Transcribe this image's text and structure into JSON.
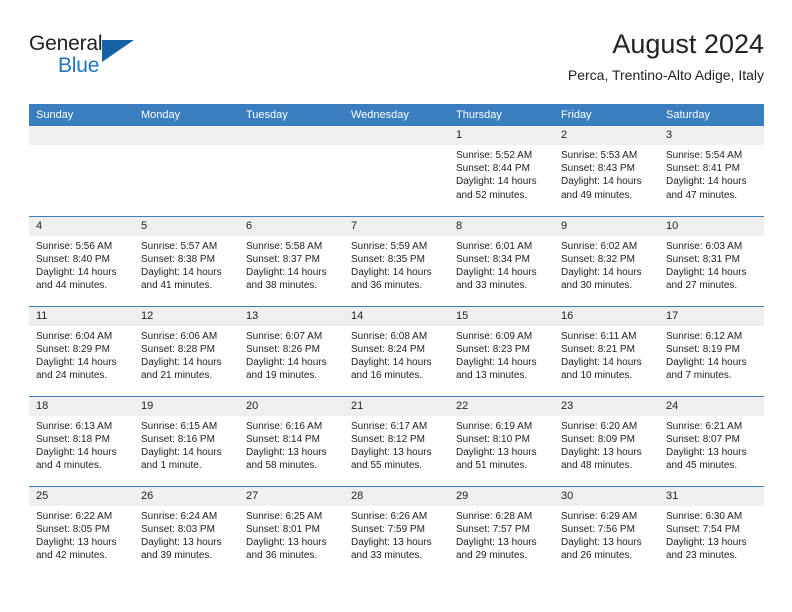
{
  "brand": {
    "word1": "General",
    "word2": "Blue",
    "accent_color": "#1464a5",
    "text_color": "#231f20"
  },
  "header": {
    "title": "August 2024",
    "subtitle": "Perca, Trentino-Alto Adige, Italy",
    "header_bg": "#3a7ebf",
    "daynum_bg": "#efefef"
  },
  "calendar": {
    "weekdays": [
      "Sunday",
      "Monday",
      "Tuesday",
      "Wednesday",
      "Thursday",
      "Friday",
      "Saturday"
    ],
    "weeks": [
      [
        {
          "day": "",
          "sunrise": "",
          "sunset": "",
          "daylight1": "",
          "daylight2": ""
        },
        {
          "day": "",
          "sunrise": "",
          "sunset": "",
          "daylight1": "",
          "daylight2": ""
        },
        {
          "day": "",
          "sunrise": "",
          "sunset": "",
          "daylight1": "",
          "daylight2": ""
        },
        {
          "day": "",
          "sunrise": "",
          "sunset": "",
          "daylight1": "",
          "daylight2": ""
        },
        {
          "day": "1",
          "sunrise": "Sunrise: 5:52 AM",
          "sunset": "Sunset: 8:44 PM",
          "daylight1": "Daylight: 14 hours",
          "daylight2": "and 52 minutes."
        },
        {
          "day": "2",
          "sunrise": "Sunrise: 5:53 AM",
          "sunset": "Sunset: 8:43 PM",
          "daylight1": "Daylight: 14 hours",
          "daylight2": "and 49 minutes."
        },
        {
          "day": "3",
          "sunrise": "Sunrise: 5:54 AM",
          "sunset": "Sunset: 8:41 PM",
          "daylight1": "Daylight: 14 hours",
          "daylight2": "and 47 minutes."
        }
      ],
      [
        {
          "day": "4",
          "sunrise": "Sunrise: 5:56 AM",
          "sunset": "Sunset: 8:40 PM",
          "daylight1": "Daylight: 14 hours",
          "daylight2": "and 44 minutes."
        },
        {
          "day": "5",
          "sunrise": "Sunrise: 5:57 AM",
          "sunset": "Sunset: 8:38 PM",
          "daylight1": "Daylight: 14 hours",
          "daylight2": "and 41 minutes."
        },
        {
          "day": "6",
          "sunrise": "Sunrise: 5:58 AM",
          "sunset": "Sunset: 8:37 PM",
          "daylight1": "Daylight: 14 hours",
          "daylight2": "and 38 minutes."
        },
        {
          "day": "7",
          "sunrise": "Sunrise: 5:59 AM",
          "sunset": "Sunset: 8:35 PM",
          "daylight1": "Daylight: 14 hours",
          "daylight2": "and 36 minutes."
        },
        {
          "day": "8",
          "sunrise": "Sunrise: 6:01 AM",
          "sunset": "Sunset: 8:34 PM",
          "daylight1": "Daylight: 14 hours",
          "daylight2": "and 33 minutes."
        },
        {
          "day": "9",
          "sunrise": "Sunrise: 6:02 AM",
          "sunset": "Sunset: 8:32 PM",
          "daylight1": "Daylight: 14 hours",
          "daylight2": "and 30 minutes."
        },
        {
          "day": "10",
          "sunrise": "Sunrise: 6:03 AM",
          "sunset": "Sunset: 8:31 PM",
          "daylight1": "Daylight: 14 hours",
          "daylight2": "and 27 minutes."
        }
      ],
      [
        {
          "day": "11",
          "sunrise": "Sunrise: 6:04 AM",
          "sunset": "Sunset: 8:29 PM",
          "daylight1": "Daylight: 14 hours",
          "daylight2": "and 24 minutes."
        },
        {
          "day": "12",
          "sunrise": "Sunrise: 6:06 AM",
          "sunset": "Sunset: 8:28 PM",
          "daylight1": "Daylight: 14 hours",
          "daylight2": "and 21 minutes."
        },
        {
          "day": "13",
          "sunrise": "Sunrise: 6:07 AM",
          "sunset": "Sunset: 8:26 PM",
          "daylight1": "Daylight: 14 hours",
          "daylight2": "and 19 minutes."
        },
        {
          "day": "14",
          "sunrise": "Sunrise: 6:08 AM",
          "sunset": "Sunset: 8:24 PM",
          "daylight1": "Daylight: 14 hours",
          "daylight2": "and 16 minutes."
        },
        {
          "day": "15",
          "sunrise": "Sunrise: 6:09 AM",
          "sunset": "Sunset: 8:23 PM",
          "daylight1": "Daylight: 14 hours",
          "daylight2": "and 13 minutes."
        },
        {
          "day": "16",
          "sunrise": "Sunrise: 6:11 AM",
          "sunset": "Sunset: 8:21 PM",
          "daylight1": "Daylight: 14 hours",
          "daylight2": "and 10 minutes."
        },
        {
          "day": "17",
          "sunrise": "Sunrise: 6:12 AM",
          "sunset": "Sunset: 8:19 PM",
          "daylight1": "Daylight: 14 hours",
          "daylight2": "and 7 minutes."
        }
      ],
      [
        {
          "day": "18",
          "sunrise": "Sunrise: 6:13 AM",
          "sunset": "Sunset: 8:18 PM",
          "daylight1": "Daylight: 14 hours",
          "daylight2": "and 4 minutes."
        },
        {
          "day": "19",
          "sunrise": "Sunrise: 6:15 AM",
          "sunset": "Sunset: 8:16 PM",
          "daylight1": "Daylight: 14 hours",
          "daylight2": "and 1 minute."
        },
        {
          "day": "20",
          "sunrise": "Sunrise: 6:16 AM",
          "sunset": "Sunset: 8:14 PM",
          "daylight1": "Daylight: 13 hours",
          "daylight2": "and 58 minutes."
        },
        {
          "day": "21",
          "sunrise": "Sunrise: 6:17 AM",
          "sunset": "Sunset: 8:12 PM",
          "daylight1": "Daylight: 13 hours",
          "daylight2": "and 55 minutes."
        },
        {
          "day": "22",
          "sunrise": "Sunrise: 6:19 AM",
          "sunset": "Sunset: 8:10 PM",
          "daylight1": "Daylight: 13 hours",
          "daylight2": "and 51 minutes."
        },
        {
          "day": "23",
          "sunrise": "Sunrise: 6:20 AM",
          "sunset": "Sunset: 8:09 PM",
          "daylight1": "Daylight: 13 hours",
          "daylight2": "and 48 minutes."
        },
        {
          "day": "24",
          "sunrise": "Sunrise: 6:21 AM",
          "sunset": "Sunset: 8:07 PM",
          "daylight1": "Daylight: 13 hours",
          "daylight2": "and 45 minutes."
        }
      ],
      [
        {
          "day": "25",
          "sunrise": "Sunrise: 6:22 AM",
          "sunset": "Sunset: 8:05 PM",
          "daylight1": "Daylight: 13 hours",
          "daylight2": "and 42 minutes."
        },
        {
          "day": "26",
          "sunrise": "Sunrise: 6:24 AM",
          "sunset": "Sunset: 8:03 PM",
          "daylight1": "Daylight: 13 hours",
          "daylight2": "and 39 minutes."
        },
        {
          "day": "27",
          "sunrise": "Sunrise: 6:25 AM",
          "sunset": "Sunset: 8:01 PM",
          "daylight1": "Daylight: 13 hours",
          "daylight2": "and 36 minutes."
        },
        {
          "day": "28",
          "sunrise": "Sunrise: 6:26 AM",
          "sunset": "Sunset: 7:59 PM",
          "daylight1": "Daylight: 13 hours",
          "daylight2": "and 33 minutes."
        },
        {
          "day": "29",
          "sunrise": "Sunrise: 6:28 AM",
          "sunset": "Sunset: 7:57 PM",
          "daylight1": "Daylight: 13 hours",
          "daylight2": "and 29 minutes."
        },
        {
          "day": "30",
          "sunrise": "Sunrise: 6:29 AM",
          "sunset": "Sunset: 7:56 PM",
          "daylight1": "Daylight: 13 hours",
          "daylight2": "and 26 minutes."
        },
        {
          "day": "31",
          "sunrise": "Sunrise: 6:30 AM",
          "sunset": "Sunset: 7:54 PM",
          "daylight1": "Daylight: 13 hours",
          "daylight2": "and 23 minutes."
        }
      ]
    ]
  }
}
